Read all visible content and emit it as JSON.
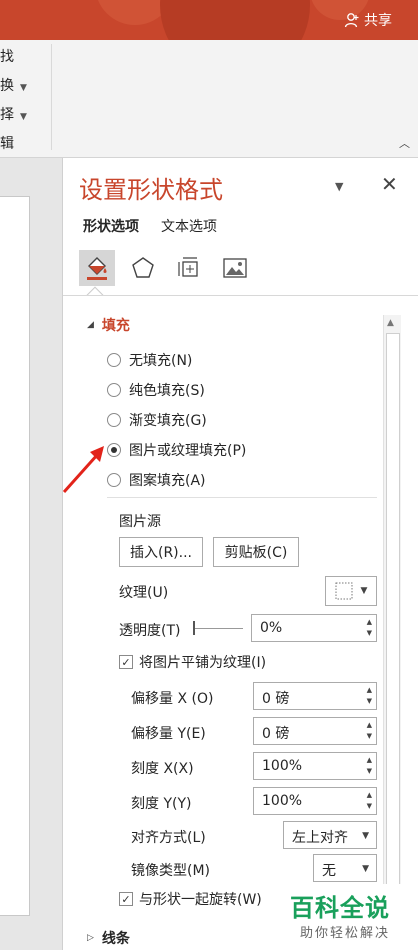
{
  "titlebar": {
    "share_label": "共享"
  },
  "ribbon": {
    "items": [
      {
        "label": "找",
        "caret": false
      },
      {
        "label": "换",
        "caret": true
      },
      {
        "label": "择",
        "caret": true
      },
      {
        "label": "辑",
        "caret": false
      }
    ]
  },
  "pane": {
    "title": "设置形状格式",
    "tabs": [
      "形状选项",
      "文本选项"
    ],
    "icons": [
      "fill-line-icon",
      "effects-pentagon-icon",
      "size-properties-icon",
      "picture-icon"
    ],
    "section_title": "填充",
    "fill_options": [
      {
        "label": "无填充(N)",
        "selected": false
      },
      {
        "label": "纯色填充(S)",
        "selected": false
      },
      {
        "label": "渐变填充(G)",
        "selected": false
      },
      {
        "label": "图片或纹理填充(P)",
        "selected": true
      },
      {
        "label": "图案填充(A)",
        "selected": false
      }
    ],
    "picture_source_label": "图片源",
    "insert_button": "插入(R)...",
    "clipboard_button": "剪贴板(C)",
    "texture_label": "纹理(U)",
    "transparency_label": "透明度(T)",
    "transparency_value": "0%",
    "tile_checkbox_label": "将图片平铺为纹理(I)",
    "tile_checked": true,
    "offset_x_label": "偏移量 X (O)",
    "offset_x_value": "0 磅",
    "offset_y_label": "偏移量 Y(E)",
    "offset_y_value": "0 磅",
    "scale_x_label": "刻度 X(X)",
    "scale_x_value": "100%",
    "scale_y_label": "刻度 Y(Y)",
    "scale_y_value": "100%",
    "align_label": "对齐方式(L)",
    "align_value": "左上对齐",
    "mirror_label": "镜像类型(M)",
    "mirror_value": "无",
    "rotate_checkbox_label": "与形状一起旋转(W)",
    "rotate_checked": true,
    "next_section": "线条"
  },
  "watermark": {
    "title": "百科全说",
    "subtitle": "助你轻松解决"
  },
  "colors": {
    "accent": "#c8462c",
    "watermark": "#19a05b"
  }
}
